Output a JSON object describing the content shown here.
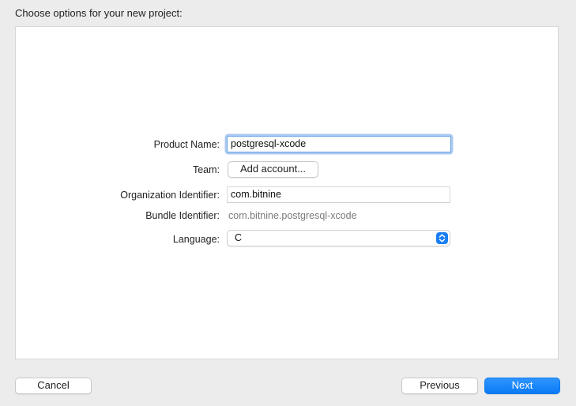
{
  "dialog": {
    "heading": "Choose options for your new project:"
  },
  "form": {
    "product_name": {
      "label": "Product Name:",
      "value": "postgresql-xcode"
    },
    "team": {
      "label": "Team:",
      "button_label": "Add account..."
    },
    "organization_identifier": {
      "label": "Organization Identifier:",
      "value": "com.bitnine"
    },
    "bundle_identifier": {
      "label": "Bundle Identifier:",
      "value": "com.bitnine.postgresql-xcode"
    },
    "language": {
      "label": "Language:",
      "selected": "C",
      "icon": "up-down-chevron-icon"
    }
  },
  "footer": {
    "cancel_label": "Cancel",
    "previous_label": "Previous",
    "next_label": "Next"
  },
  "colors": {
    "accent": "#0a84ff",
    "focus_ring": "#a9c9f0",
    "secondary_text": "#7a7a7a"
  }
}
